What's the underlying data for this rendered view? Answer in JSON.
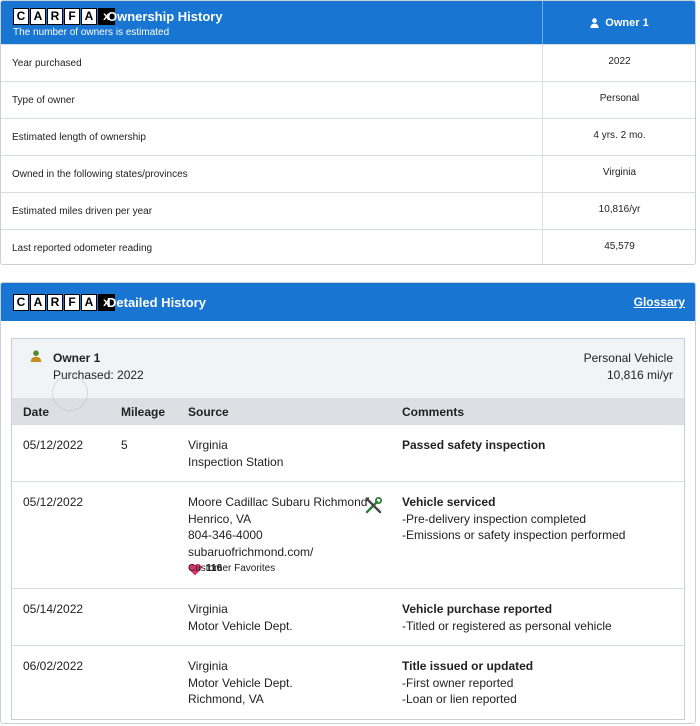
{
  "colors": {
    "header_blue": "#1875d1",
    "favorite_heart": "#d6336c",
    "tools_green": "#2e7d32"
  },
  "icons": {
    "logo": "carfax-logo",
    "owner": "person-icon",
    "service": "tools-icon",
    "favorite": "heart-icon"
  },
  "ownership": {
    "logo": {
      "letters": [
        "C",
        "A",
        "R",
        "F",
        "A",
        "X"
      ],
      "last": "x"
    },
    "title": "Ownership History",
    "subtitle": "The number of owners is estimated",
    "owner_col": "Owner 1",
    "rows": [
      {
        "label": "Year purchased",
        "value": "2022"
      },
      {
        "label": "Type of owner",
        "value": "Personal"
      },
      {
        "label": "Estimated length of ownership",
        "value": "4 yrs. 2 mo."
      },
      {
        "label": "Owned in the following states/provinces",
        "value": "Virginia"
      },
      {
        "label": "Estimated miles driven per year",
        "value": "10,816/yr"
      },
      {
        "label": "Last reported odometer reading",
        "value": "45,579"
      }
    ]
  },
  "detailed": {
    "title": "Detailed History",
    "glossary": "Glossary",
    "owner_card": {
      "owner": "Owner 1",
      "purchased": "Purchased: 2022",
      "vehicle_type": "Personal Vehicle",
      "miles": "10,816 mi/yr"
    },
    "columns": {
      "date": "Date",
      "mileage": "Mileage",
      "source": "Source",
      "comments": "Comments"
    },
    "records": [
      {
        "date": "05/12/2022",
        "mileage": "5",
        "source": [
          "Virginia",
          "Inspection Station"
        ],
        "comment_title": "Passed safety inspection",
        "comments": []
      },
      {
        "date": "05/12/2022",
        "mileage": "",
        "source": [
          "Moore Cadillac Subaru Richmond",
          "Henrico, VA",
          "804-346-4000",
          "subaruofrichmond.com/"
        ],
        "favorites_count": "116",
        "favorites_label": "Customer Favorites",
        "comment_title": "Vehicle serviced",
        "comments": [
          "-Pre-delivery inspection completed",
          "-Emissions or safety inspection performed"
        ]
      },
      {
        "date": "05/14/2022",
        "mileage": "",
        "source": [
          "Virginia",
          "Motor Vehicle Dept."
        ],
        "comment_title": "Vehicle purchase reported",
        "comments": [
          "-Titled or registered as personal vehicle"
        ]
      },
      {
        "date": "06/02/2022",
        "mileage": "",
        "source": [
          "Virginia",
          "Motor Vehicle Dept.",
          "Richmond, VA"
        ],
        "comment_title": "Title issued or updated",
        "comments": [
          "-First owner reported",
          "-Loan or lien reported"
        ]
      }
    ]
  }
}
